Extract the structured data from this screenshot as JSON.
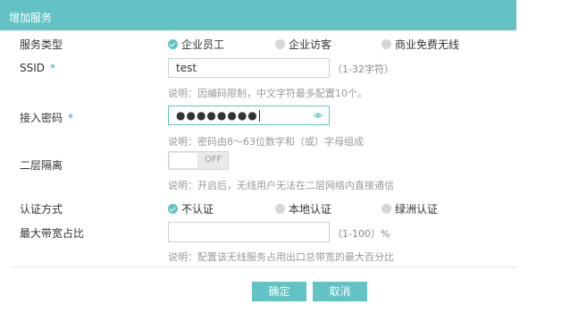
{
  "header": {
    "title": "增加服务"
  },
  "service_type": {
    "label": "服务类型",
    "options": [
      {
        "label": "企业员工",
        "checked": true
      },
      {
        "label": "企业访客",
        "checked": false
      },
      {
        "label": "商业免费无线",
        "checked": false
      }
    ]
  },
  "ssid": {
    "label": "SSID",
    "required_mark": "*",
    "value": "test",
    "suffix": "（1-32字符）",
    "note": "说明：因编码限制，中文字符最多配置10个。"
  },
  "password": {
    "label": "接入密码",
    "required_mark": "*",
    "masked_value": "●●●●●●●●",
    "note": "说明：密码由8～63位数字和（或）字母组成",
    "icon": "eye-icon"
  },
  "isolation": {
    "label": "二层隔离",
    "toggle_text": "OFF",
    "enabled": false,
    "note": "说明：开启后，无线用户无法在二层网络内直接通信"
  },
  "auth": {
    "label": "认证方式",
    "options": [
      {
        "label": "不认证",
        "checked": true
      },
      {
        "label": "本地认证",
        "checked": false
      },
      {
        "label": "绿洲认证",
        "checked": false
      }
    ]
  },
  "bandwidth": {
    "label": "最大带宽占比",
    "value": "",
    "suffix": "（1-100）%",
    "note": "说明：配置该无线服务占用出口总带宽的最大百分比"
  },
  "actions": {
    "confirm": "确定",
    "cancel": "取消"
  },
  "colors": {
    "accent": "#62c2c4",
    "radio_off": "#d6d6d6"
  }
}
